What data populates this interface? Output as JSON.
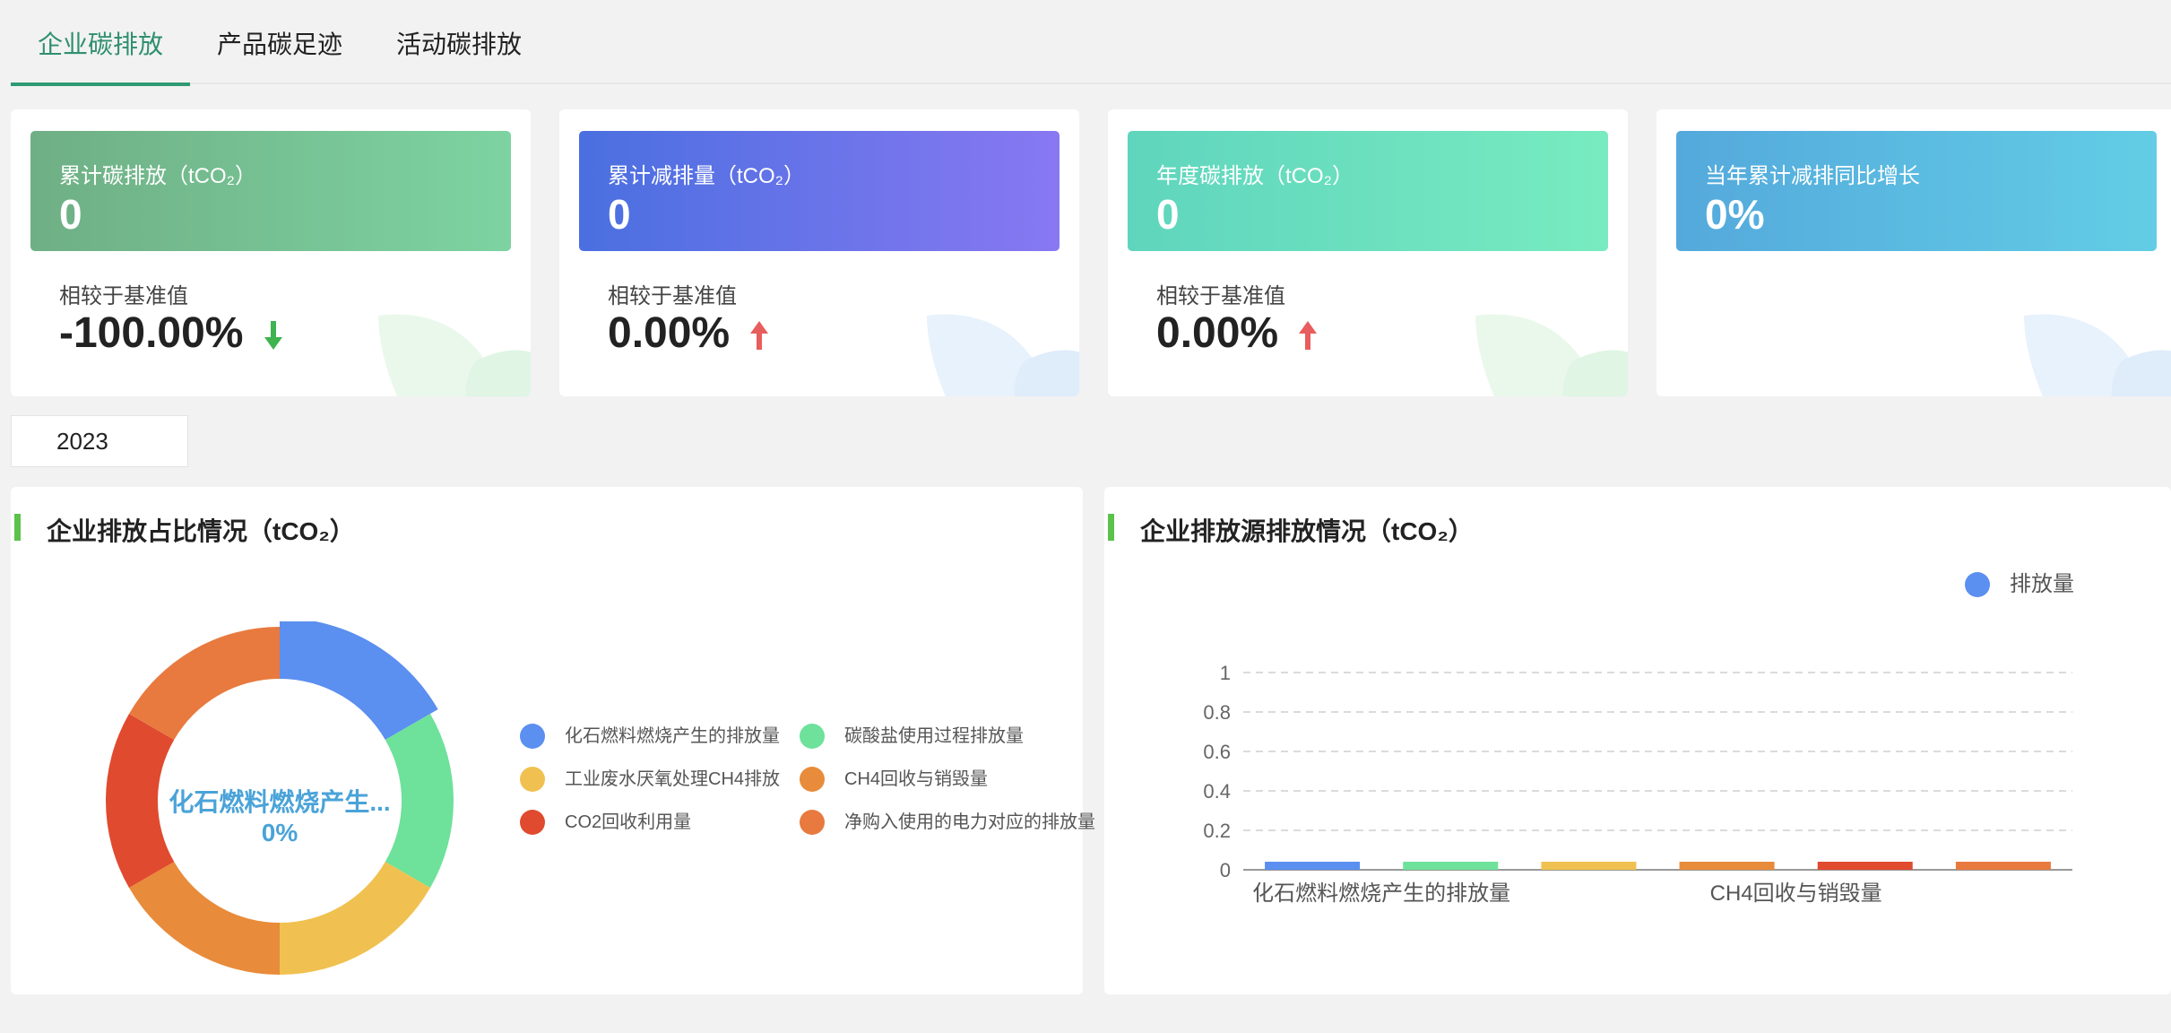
{
  "tabs": [
    "企业碳排放",
    "产品碳足迹",
    "活动碳排放"
  ],
  "cards": [
    {
      "label": "累计碳排放（tCO₂）",
      "value": "0",
      "sub": "相较于基准值",
      "pct": "-100.00%",
      "trend": "down"
    },
    {
      "label": "累计减排量（tCO₂）",
      "value": "0",
      "sub": "相较于基准值",
      "pct": "0.00%",
      "trend": "up"
    },
    {
      "label": "年度碳排放（tCO₂）",
      "value": "0",
      "sub": "相较于基准值",
      "pct": "0.00%",
      "trend": "up"
    },
    {
      "label": "当年累计减排同比增长",
      "value": "0%"
    }
  ],
  "colors": {
    "tab_active": "#2f8f6e",
    "card1": [
      "#6faf85",
      "#7dd3a1"
    ],
    "card2": [
      "#4a6fe0",
      "#8878f2"
    ],
    "card3": [
      "#5fd5bd",
      "#78ebc0"
    ],
    "card4": [
      "#54a9dc",
      "#62cde5"
    ],
    "arrow_down": "#3fb34f",
    "arrow_up": "#e85d5d",
    "title_bar": "#5bc24a"
  },
  "year": "2023",
  "left_panel": {
    "title": "企业排放占比情况（tCO₂）",
    "center_label": "化石燃料燃烧产生...",
    "center_value": "0%",
    "legend": [
      {
        "name": "化石燃料燃烧产生的排放量",
        "color": "#5b8ff0"
      },
      {
        "name": "碳酸盐使用过程排放量",
        "color": "#6ee19a"
      },
      {
        "name": "工业废水厌氧处理CH4排放",
        "color": "#f0c150"
      },
      {
        "name": "CH4回收与销毁量",
        "color": "#e88b3a"
      },
      {
        "name": "CO2回收利用量",
        "color": "#e04a2f"
      },
      {
        "name": "净购入使用的电力对应的排放量",
        "color": "#e87a3f"
      }
    ]
  },
  "right_panel": {
    "title": "企业排放源排放情况（tCO₂）",
    "legend": "排放量",
    "legend_color": "#5b8ff0"
  },
  "chart_data": {
    "type": "bar",
    "categories": [
      "化石燃料燃烧产生的排放量",
      "碳酸盐使用过程排放量",
      "工业废水厌氧处理CH4排放",
      "CH4回收与销毁量",
      "CO2回收利用量",
      "净购入使用的电力对应的排放量"
    ],
    "visible_xticks": [
      "化石燃料燃烧产生的排放量",
      "CH4回收与销毁量"
    ],
    "series": [
      {
        "name": "排放量",
        "values": [
          0,
          0,
          0,
          0,
          0,
          0
        ]
      }
    ],
    "bar_colors": [
      "#5b8ff0",
      "#6ee19a",
      "#f0c150",
      "#e88b3a",
      "#e04a2f",
      "#e87a3f"
    ],
    "ylim": [
      0,
      1
    ],
    "yticks": [
      "0",
      "0.2",
      "0.4",
      "0.6",
      "0.8",
      "1"
    ],
    "grid": true,
    "legend_position": "top-right"
  }
}
